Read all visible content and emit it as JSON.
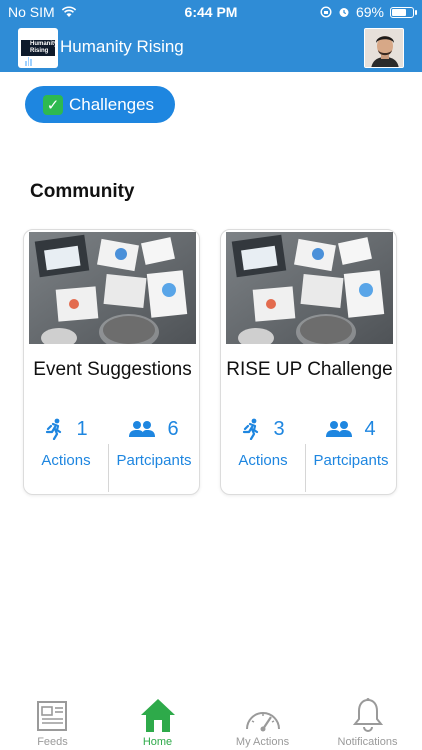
{
  "status_bar": {
    "carrier": "No SIM",
    "time": "6:44 PM",
    "battery": "69%",
    "battery_level": 0.69
  },
  "header": {
    "title": "Humanity Rising",
    "logo_text": "Humanity Rising"
  },
  "challenges_button": {
    "label": "Challenges"
  },
  "section": {
    "title": "Community"
  },
  "cards": [
    {
      "title": "Event Suggestions",
      "actions_count": "1",
      "actions_label": "Actions",
      "participants_count": "6",
      "participants_label": "Partcipants"
    },
    {
      "title": "RISE UP Challenge",
      "actions_count": "3",
      "actions_label": "Actions",
      "participants_count": "4",
      "participants_label": "Partcipants"
    }
  ],
  "tabs": [
    {
      "label": "Feeds",
      "icon": "newspaper-icon"
    },
    {
      "label": "Home",
      "icon": "home-icon",
      "active": true
    },
    {
      "label": "My Actions",
      "icon": "speedometer-icon"
    },
    {
      "label": "Notifications",
      "icon": "bell-icon"
    }
  ],
  "colors": {
    "primary": "#2f8cd6",
    "button": "#1e86e0",
    "active_tab": "#2eaa4a",
    "inactive_tab": "#9a9a9a"
  }
}
